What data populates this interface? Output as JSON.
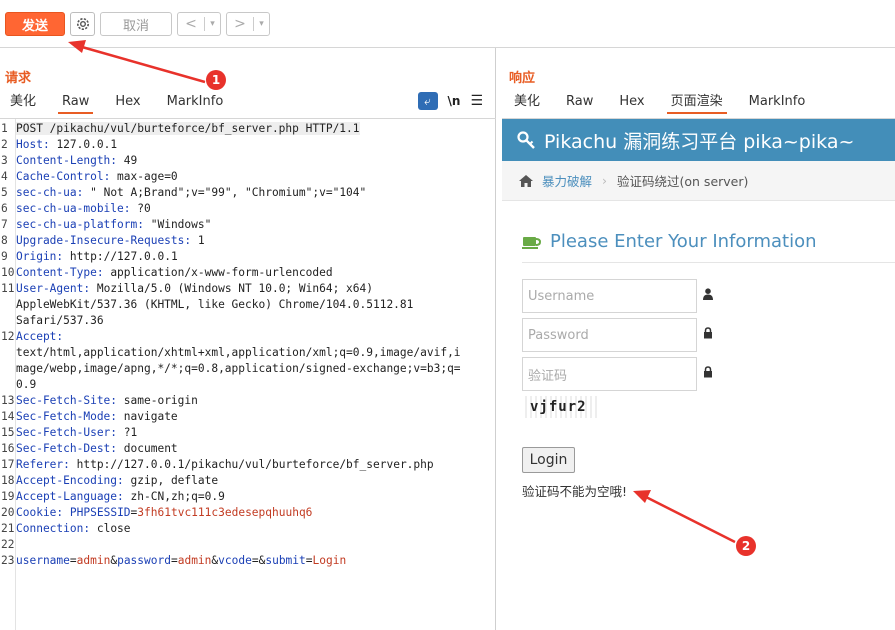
{
  "toolbar": {
    "send_label": "发送",
    "cancel_label": "取消",
    "back_symbol": "<",
    "forward_symbol": ">",
    "dropdown_symbol": "▾"
  },
  "request": {
    "title": "请求",
    "tabs": [
      "美化",
      "Raw",
      "Hex",
      "MarkInfo"
    ],
    "active_tab": "Raw",
    "tool_nl_label": "\\n",
    "lines": [
      {
        "n": "1",
        "text": "POST /pikachu/vul/burteforce/bf_server.php HTTP/1.1"
      },
      {
        "n": "2",
        "key": "Host",
        "val": " 127.0.0.1"
      },
      {
        "n": "3",
        "key": "Content-Length",
        "val": " 49"
      },
      {
        "n": "4",
        "key": "Cache-Control",
        "val": " max-age=0"
      },
      {
        "n": "5",
        "key": "sec-ch-ua",
        "val": " \" Not A;Brand\";v=\"99\", \"Chromium\";v=\"104\""
      },
      {
        "n": "6",
        "key": "sec-ch-ua-mobile",
        "val": " ?0"
      },
      {
        "n": "7",
        "key": "sec-ch-ua-platform",
        "val": " \"Windows\""
      },
      {
        "n": "8",
        "key": "Upgrade-Insecure-Requests",
        "val": " 1"
      },
      {
        "n": "9",
        "key": "Origin",
        "val": " http://127.0.0.1"
      },
      {
        "n": "10",
        "key": "Content-Type",
        "val": " application/x-www-form-urlencoded"
      },
      {
        "n": "11",
        "key": "User-Agent",
        "val": " Mozilla/5.0 (Windows NT 10.0; Win64; x64)"
      },
      {
        "n": "",
        "text": "AppleWebKit/537.36 (KHTML, like Gecko) Chrome/104.0.5112.81"
      },
      {
        "n": "",
        "text": "Safari/537.36"
      },
      {
        "n": "12",
        "key": "Accept",
        "val": ""
      },
      {
        "n": "",
        "text": "text/html,application/xhtml+xml,application/xml;q=0.9,image/avif,i"
      },
      {
        "n": "",
        "text": "mage/webp,image/apng,*/*;q=0.8,application/signed-exchange;v=b3;q="
      },
      {
        "n": "",
        "text": "0.9"
      },
      {
        "n": "13",
        "key": "Sec-Fetch-Site",
        "val": " same-origin"
      },
      {
        "n": "14",
        "key": "Sec-Fetch-Mode",
        "val": " navigate"
      },
      {
        "n": "15",
        "key": "Sec-Fetch-User",
        "val": " ?1"
      },
      {
        "n": "16",
        "key": "Sec-Fetch-Dest",
        "val": " document"
      },
      {
        "n": "17",
        "key": "Referer",
        "val": " http://127.0.0.1/pikachu/vul/burteforce/bf_server.php"
      },
      {
        "n": "18",
        "key": "Accept-Encoding",
        "val": " gzip, deflate"
      },
      {
        "n": "19",
        "key": "Accept-Language",
        "val": " zh-CN,zh;q=0.9"
      },
      {
        "n": "20",
        "key": "Cookie",
        "val": " ",
        "cookie_name": "PHPSESSID",
        "cookie_eq": "=",
        "cookie_val": "3fh61tvc111c3edesepqhuuhq6"
      },
      {
        "n": "21",
        "key": "Connection",
        "val": " close"
      },
      {
        "n": "22",
        "text": ""
      },
      {
        "n": "23",
        "params": [
          {
            "k": "username",
            "v": "admin"
          },
          {
            "k": "password",
            "v": "admin"
          },
          {
            "k": "vcode",
            "v": ""
          },
          {
            "k": "submit",
            "v": "Login"
          }
        ]
      }
    ]
  },
  "response": {
    "title": "响应",
    "tabs": [
      "美化",
      "Raw",
      "Hex",
      "页面渲染",
      "MarkInfo"
    ],
    "active_tab": "页面渲染",
    "page": {
      "header": "Pikachu 漏洞练习平台 pika~pika~",
      "breadcrumb_link": "暴力破解",
      "breadcrumb_sep": "›",
      "breadcrumb_current": "验证码绕过(on server)",
      "section_title": "Please Enter Your Information",
      "username_placeholder": "Username",
      "password_placeholder": "Password",
      "vcode_placeholder": "验证码",
      "captcha_text": "vjfur2",
      "login_label": "Login",
      "error_message": "验证码不能为空哦!"
    }
  },
  "annotations": {
    "badge_1": "1",
    "badge_2": "2",
    "color": "#e8322b"
  },
  "colors": {
    "accent": "#ff6633",
    "header_blue": "#438eb9",
    "link_blue": "#4c8fbd",
    "key_blue": "#1a3fb5",
    "value_red": "#c23b22"
  }
}
